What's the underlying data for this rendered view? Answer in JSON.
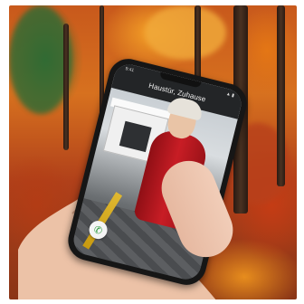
{
  "photo": {
    "scene": "autumn-forest-background",
    "palette": {
      "orange": "#d7711f",
      "red": "#c81d25",
      "green": "#2e6b35",
      "dark": "#2a1a12"
    }
  },
  "phone": {
    "app_title": "Haustür, Zuhause",
    "status_left": "9:41",
    "status_right": "▲ ▮",
    "call_icon": "phone-icon",
    "call_glyph": "✆"
  }
}
